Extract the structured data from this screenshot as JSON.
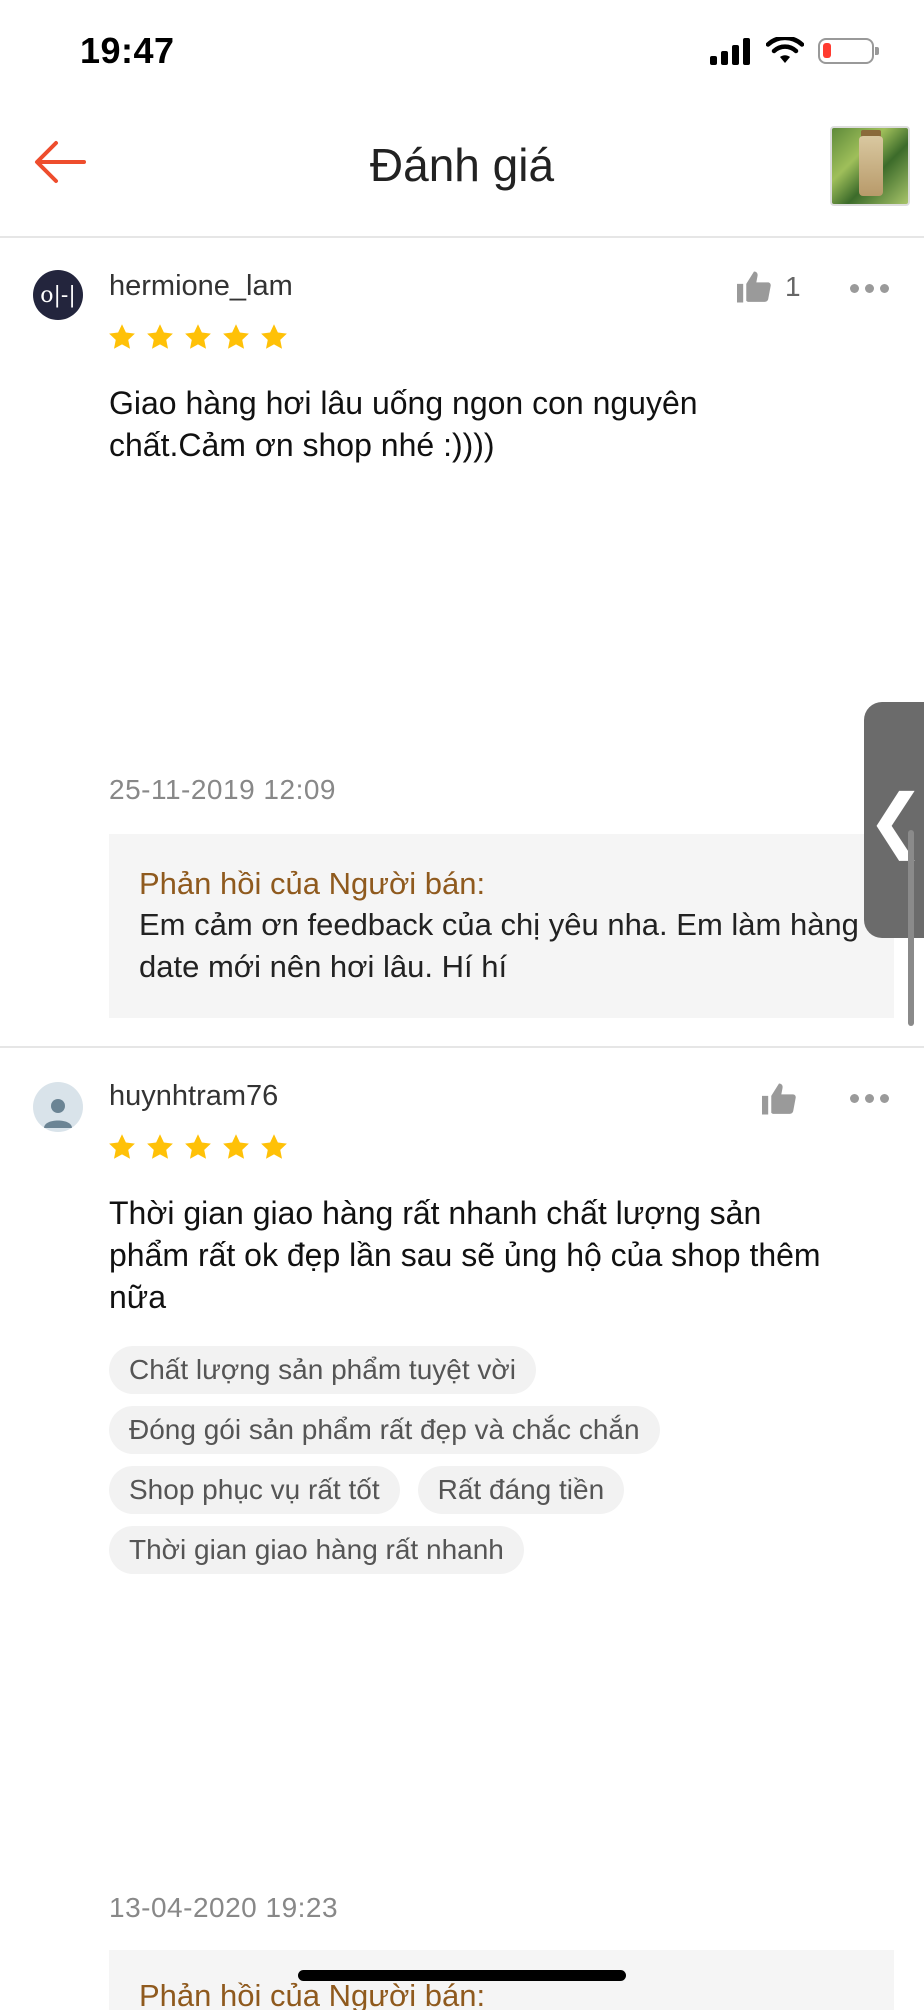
{
  "status_bar": {
    "time": "19:47"
  },
  "header": {
    "title": "Đánh giá",
    "back_icon": "arrow-left-icon",
    "accent_color": "#ee4d2d"
  },
  "reviews": [
    {
      "username": "hermione_lam",
      "avatar_text": "o|-|",
      "rating": 5,
      "likes": "1",
      "text": "Giao hàng hơi lâu uống ngon con nguyên chất.Cảm ơn shop nhé :))))",
      "date": "25-11-2019 12:09",
      "reply_title": "Phản hồi của Người bán:",
      "reply_text": "Em cảm ơn feedback của chị yêu nha. Em làm hàng date mới nên hơi lâu. Hí hí"
    },
    {
      "username": "huynhtram76",
      "rating": 5,
      "likes": "",
      "text": "Thời gian giao hàng rất nhanh chất lượng sản phẩm rất ok đẹp lần sau sẽ ủng hộ của shop thêm nữa",
      "tags": [
        "Chất lượng sản phẩm tuyệt vời",
        "Đóng gói sản phẩm rất đẹp và chắc chắn",
        "Shop phục vụ rất tốt",
        "Rất đáng tiền",
        "Thời gian giao hàng rất nhanh"
      ],
      "date": "13-04-2020 19:23",
      "reply_title": "Phản hồi của Người bán:"
    }
  ],
  "side_tab": {
    "icon": "chevron-left-icon",
    "glyph": "❮"
  },
  "colors": {
    "star": "#ffc107",
    "reply_title": "#8f5a1e"
  }
}
